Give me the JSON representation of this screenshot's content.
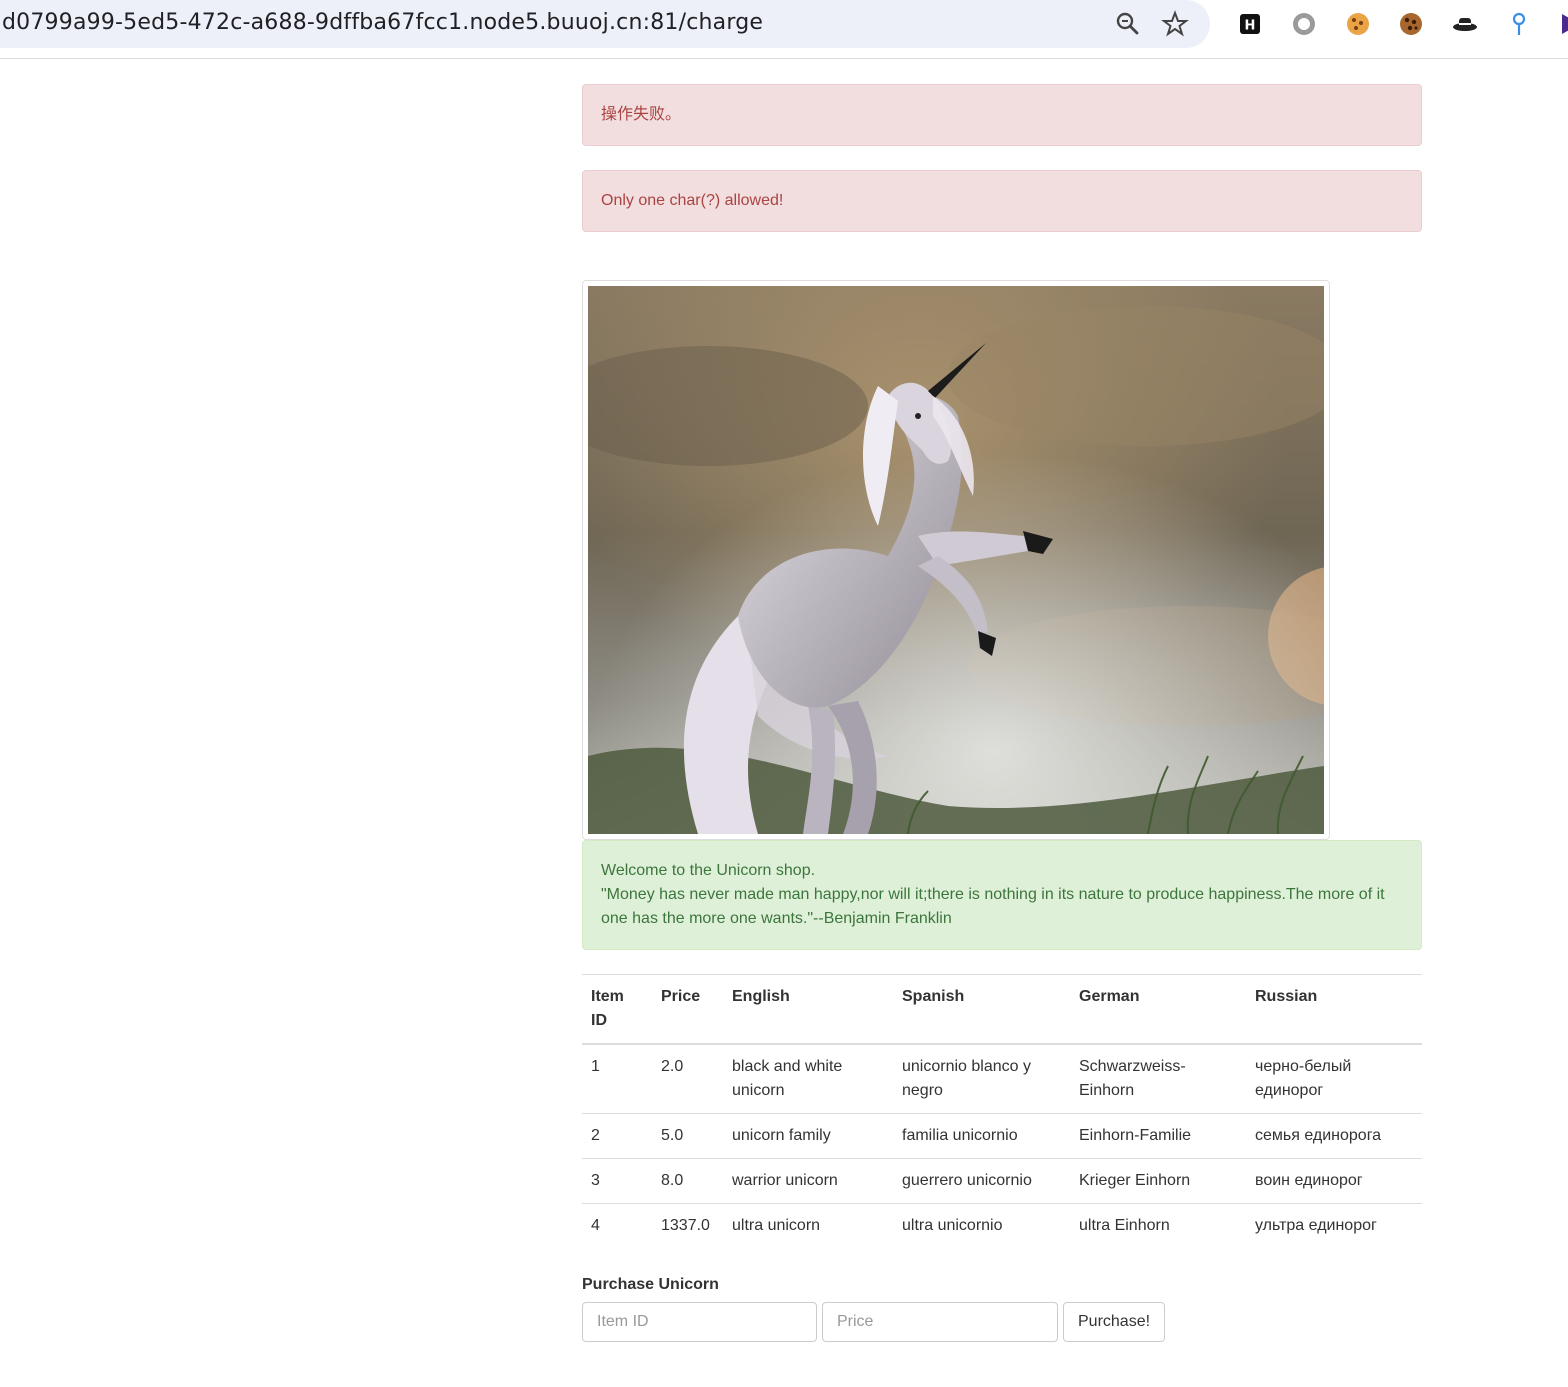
{
  "browser": {
    "url": "d0799a99-5ed5-472c-a688-9dffba67fcc1.node5.buuoj.cn:81/charge",
    "omnibox_icons": [
      "zoom-icon",
      "bookmark-star-icon"
    ],
    "extension_icons": [
      "h-extension-icon",
      "record-extension-icon",
      "cookie-extension-icon",
      "cookie-editor-icon",
      "hat-extension-icon",
      "pin-extension-icon"
    ]
  },
  "alerts": {
    "error1": "操作失败。",
    "error2": "Only one char(?) allowed!"
  },
  "image": {
    "subject": "unicorn-rearing-image"
  },
  "welcome": {
    "line1": "Welcome to the Unicorn shop.",
    "line2": "\"Money has never made man happy,nor will it;there is nothing in its nature to produce happiness.The more of it one has the more one wants.\"--Benjamin Franklin"
  },
  "table": {
    "headers": [
      "Item ID",
      "Price",
      "English",
      "Spanish",
      "German",
      "Russian"
    ],
    "rows": [
      [
        "1",
        "2.0",
        "black and white unicorn",
        "unicornio blanco y negro",
        "Schwarzweiss-Einhorn",
        "черно-белый единорог"
      ],
      [
        "2",
        "5.0",
        "unicorn family",
        "familia unicornio",
        "Einhorn-Familie",
        "семья единорога"
      ],
      [
        "3",
        "8.0",
        "warrior unicorn",
        "guerrero unicornio",
        "Krieger Einhorn",
        "воин единорог"
      ],
      [
        "4",
        "1337.0",
        "ultra unicorn",
        "ultra unicornio",
        "ultra Einhorn",
        "ультра единорог"
      ]
    ]
  },
  "form": {
    "title": "Purchase Unicorn",
    "item_id_placeholder": "Item ID",
    "price_placeholder": "Price",
    "submit_label": "Purchase!"
  },
  "colors": {
    "danger_bg": "#f2dede",
    "danger_text": "#a94442",
    "success_bg": "#dff0d8",
    "success_text": "#3c763d"
  }
}
